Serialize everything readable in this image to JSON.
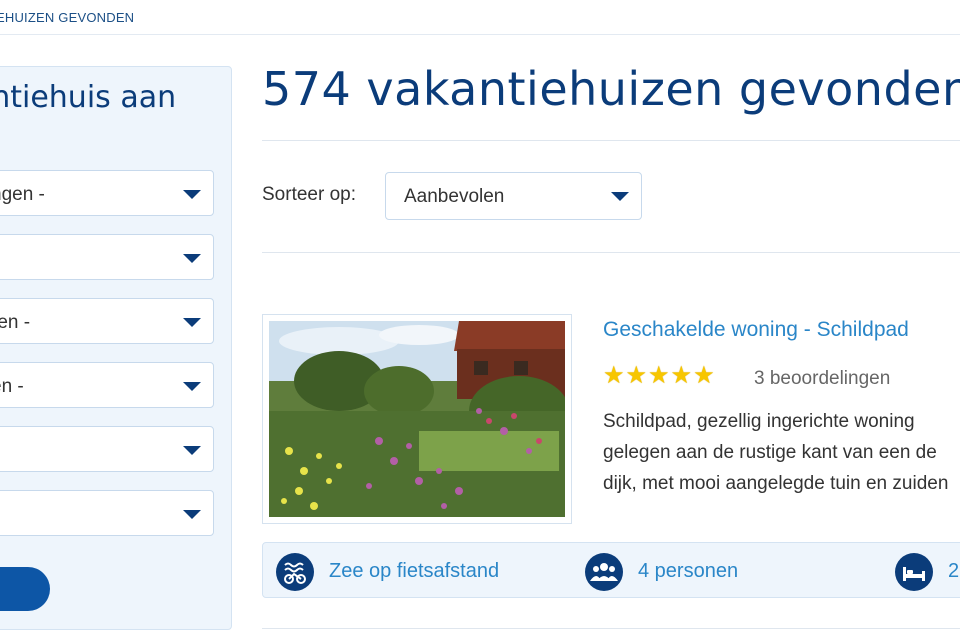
{
  "breadcrumb": {
    "text": "EHUIZEN GEVONDEN"
  },
  "search_panel": {
    "title": "kantiehuis aan",
    "filters": [
      {
        "value": "ngen -"
      },
      {
        "value": ""
      },
      {
        "value": "ren -"
      },
      {
        "value": "en -"
      },
      {
        "value": ""
      },
      {
        "value": ""
      }
    ]
  },
  "results": {
    "heading": "574 vakantiehuizen gevonden",
    "sort_label": "Sorteer op:",
    "sort_value": "Aanbevolen"
  },
  "listing": {
    "title": "Geschakelde woning - Schildpad",
    "rating_stars": 5,
    "reviews": "3 beoordelingen",
    "description": "Schildpad, gezellig ingerichte woning gelegen aan de rustige kant van een de dijk, met mooi aangelegde tuin en zuiden",
    "features": [
      {
        "icon": "bike-waves-icon",
        "label": "Zee op fietsafstand"
      },
      {
        "icon": "people-icon",
        "label": "4 personen"
      },
      {
        "icon": "bed-icon",
        "label": "2"
      }
    ]
  },
  "colors": {
    "brand_dark": "#0b3c7a",
    "link": "#2a86c8",
    "panel_bg": "#eef5fc",
    "button": "#0d56a6",
    "star": "#f7c600"
  }
}
